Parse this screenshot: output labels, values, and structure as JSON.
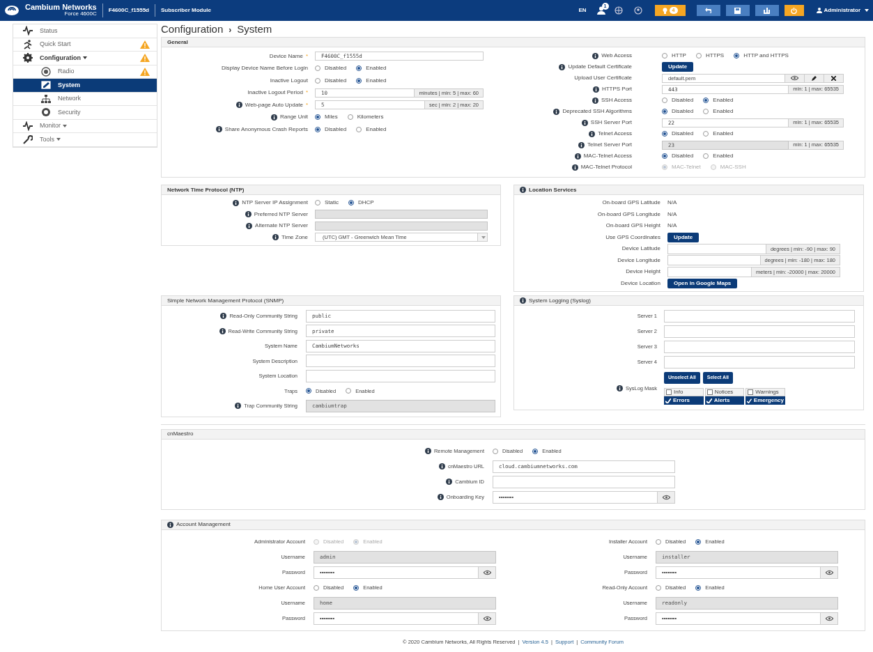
{
  "topbar": {
    "brand": "Cambium Networks",
    "model": "Force 4600C",
    "device": "F4600C_f1555d",
    "mode": "Subscriber Module",
    "language": "EN",
    "notification_badge": "1",
    "alert_badge": "4",
    "user": "Administrator"
  },
  "sidebar": [
    {
      "label": "Status",
      "warning": false,
      "selected": false
    },
    {
      "label": "Quick Start",
      "warning": true,
      "selected": false
    },
    {
      "label": "Configuration",
      "warning": true,
      "selected": false,
      "expanded": true,
      "children": [
        {
          "label": "Radio",
          "warning": true,
          "selected": false
        },
        {
          "label": "System",
          "warning": false,
          "selected": true
        },
        {
          "label": "Network",
          "warning": false,
          "selected": false
        },
        {
          "label": "Security",
          "warning": false,
          "selected": false
        }
      ]
    },
    {
      "label": "Monitor",
      "warning": false,
      "selected": false,
      "expanded": false
    },
    {
      "label": "Tools",
      "warning": false,
      "selected": false,
      "expanded": false
    }
  ],
  "breadcrumb": {
    "parts": [
      "Configuration",
      "System"
    ],
    "separator": "›"
  },
  "general": {
    "title": "General",
    "left": [
      {
        "kind": "input",
        "label": "Device Name",
        "required": "*",
        "info": false,
        "value": "F4600C_f1555d",
        "disabled": false
      },
      {
        "kind": "radio",
        "label": "Display Device Name Before Login",
        "info": false,
        "disabled": false,
        "options": [
          {
            "label": "Disabled",
            "selected": false
          },
          {
            "label": "Enabled",
            "selected": true
          }
        ]
      },
      {
        "kind": "radio",
        "label": "Inactive Logout",
        "info": false,
        "disabled": false,
        "options": [
          {
            "label": "Disabled",
            "selected": false
          },
          {
            "label": "Enabled",
            "selected": true
          }
        ]
      },
      {
        "kind": "input",
        "label": "Inactive Logout Period",
        "required": "*",
        "info": false,
        "value": "10",
        "addon": "minutes | min: 5 | max: 60",
        "disabled": false
      },
      {
        "kind": "input",
        "label": "Web-page Auto Update",
        "required": "*",
        "info": true,
        "value": "5",
        "addon": "sec | min: 2 | max: 20",
        "disabled": false
      },
      {
        "kind": "radio",
        "label": "Range Unit",
        "info": true,
        "disabled": false,
        "options": [
          {
            "label": "Miles",
            "selected": true
          },
          {
            "label": "Kilometers",
            "selected": false
          }
        ]
      },
      {
        "kind": "radio",
        "label": "Share Anonymous Crash Reports",
        "info": true,
        "disabled": false,
        "options": [
          {
            "label": "Disabled",
            "selected": true
          },
          {
            "label": "Enabled",
            "selected": false
          }
        ]
      }
    ],
    "right": [
      {
        "kind": "radio",
        "label": "Web Access",
        "info": true,
        "disabled": false,
        "options": [
          {
            "label": "HTTP",
            "selected": false
          },
          {
            "label": "HTTPS",
            "selected": false
          },
          {
            "label": "HTTP and HTTPS",
            "selected": true
          }
        ]
      },
      {
        "kind": "button",
        "label": "Update Default Certificate",
        "info": true,
        "button": "Update"
      },
      {
        "kind": "file",
        "label": "Upload User Certificate",
        "info": false,
        "value": "default.pem"
      },
      {
        "kind": "input",
        "label": "HTTPS Port",
        "info": true,
        "value": "443",
        "addon": "min: 1 | max: 65535",
        "disabled": false
      },
      {
        "kind": "radio",
        "label": "SSH Access",
        "info": true,
        "disabled": false,
        "options": [
          {
            "label": "Disabled",
            "selected": false
          },
          {
            "label": "Enabled",
            "selected": true
          }
        ]
      },
      {
        "kind": "radio",
        "label": "Deprecated SSH Algorithms",
        "info": true,
        "disabled": false,
        "options": [
          {
            "label": "Disabled",
            "selected": true
          },
          {
            "label": "Enabled",
            "selected": false
          }
        ]
      },
      {
        "kind": "input",
        "label": "SSH Server Port",
        "info": true,
        "value": "22",
        "addon": "min: 1 | max: 65535",
        "disabled": false
      },
      {
        "kind": "radio",
        "label": "Telnet Access",
        "info": true,
        "disabled": false,
        "options": [
          {
            "label": "Disabled",
            "selected": true
          },
          {
            "label": "Enabled",
            "selected": false
          }
        ]
      },
      {
        "kind": "input",
        "label": "Telnet Server Port",
        "info": true,
        "value": "23",
        "addon": "min: 1 | max: 65535",
        "disabled": true
      },
      {
        "kind": "radio",
        "label": "MAC-Telnet Access",
        "info": true,
        "disabled": false,
        "options": [
          {
            "label": "Disabled",
            "selected": true
          },
          {
            "label": "Enabled",
            "selected": false
          }
        ]
      },
      {
        "kind": "radio",
        "label": "MAC-Telnet Protocol",
        "info": true,
        "disabled": true,
        "options": [
          {
            "label": "MAC-Telnet",
            "selected": true
          },
          {
            "label": "MAC-SSH",
            "selected": false
          }
        ]
      }
    ]
  },
  "ntp": {
    "title": "Network Time Protocol (NTP)",
    "info": false,
    "rows": [
      {
        "kind": "radio",
        "label": "NTP Server IP Assignment",
        "info": true,
        "disabled": false,
        "options": [
          {
            "label": "Static",
            "selected": false
          },
          {
            "label": "DHCP",
            "selected": true
          }
        ]
      },
      {
        "kind": "input",
        "label": "Preferred NTP Server",
        "info": true,
        "value": "",
        "disabled": true
      },
      {
        "kind": "input",
        "label": "Alternate NTP Server",
        "info": true,
        "value": "",
        "disabled": true
      },
      {
        "kind": "select",
        "label": "Time Zone",
        "info": true,
        "value": "(UTC) GMT - Greenwich Mean Time"
      }
    ]
  },
  "location": {
    "title": "Location Services",
    "info": true,
    "rows": [
      {
        "kind": "static",
        "label": "On-board GPS Latitude",
        "info": false,
        "value": "N/A"
      },
      {
        "kind": "static",
        "label": "On-board GPS Longitude",
        "info": false,
        "value": "N/A"
      },
      {
        "kind": "static",
        "label": "On-board GPS Height",
        "info": false,
        "value": "N/A"
      },
      {
        "kind": "button",
        "label": "Use GPS Coordinates",
        "info": false,
        "button": "Update"
      },
      {
        "kind": "input",
        "label": "Device Latitude",
        "info": false,
        "value": "",
        "addon": "degrees | min: -90 | max: 90",
        "disabled": false
      },
      {
        "kind": "input",
        "label": "Device Longitude",
        "info": false,
        "value": "",
        "addon": "degrees | min: -180 | max: 180",
        "disabled": false
      },
      {
        "kind": "input",
        "label": "Device Height",
        "info": false,
        "value": "",
        "addon": "meters | min: -20000 | max: 20000",
        "disabled": false
      },
      {
        "kind": "button",
        "label": "Device Location",
        "info": false,
        "button": "Open in Google Maps"
      }
    ]
  },
  "snmp": {
    "title": "Simple Network Management Protocol (SNMP)",
    "info": false,
    "rows": [
      {
        "kind": "input",
        "label": "Read-Only Community String",
        "info": true,
        "value": "public",
        "disabled": false
      },
      {
        "kind": "input",
        "label": "Read-Write Community String",
        "info": true,
        "value": "private",
        "disabled": false
      },
      {
        "kind": "input",
        "label": "System Name",
        "info": false,
        "value": "CambiumNetworks",
        "disabled": false
      },
      {
        "kind": "input",
        "label": "System Description",
        "info": false,
        "value": "",
        "disabled": false
      },
      {
        "kind": "input",
        "label": "System Location",
        "info": false,
        "value": "",
        "disabled": false
      },
      {
        "kind": "radio",
        "label": "Traps",
        "info": false,
        "disabled": false,
        "options": [
          {
            "label": "Disabled",
            "selected": true
          },
          {
            "label": "Enabled",
            "selected": false
          }
        ]
      },
      {
        "kind": "input",
        "label": "Trap Community String",
        "info": true,
        "value": "cambiumtrap",
        "disabled": true
      }
    ]
  },
  "syslog": {
    "title": "System Logging (Syslog)",
    "info": true,
    "rows": [
      {
        "kind": "input",
        "label": "Server 1",
        "info": false,
        "value": "",
        "disabled": false
      },
      {
        "kind": "input",
        "label": "Server 2",
        "info": false,
        "value": "",
        "disabled": false
      },
      {
        "kind": "input",
        "label": "Server 3",
        "info": false,
        "value": "",
        "disabled": false
      },
      {
        "kind": "input",
        "label": "Server 4",
        "info": false,
        "value": "",
        "disabled": false
      },
      {
        "kind": "mask",
        "label": "SysLog Mask",
        "info": true,
        "buttons": [
          "Unselect All",
          "Select All"
        ],
        "checks": [
          {
            "label": "Info",
            "checked": false
          },
          {
            "label": "Notices",
            "checked": false
          },
          {
            "label": "Warnings",
            "checked": false
          },
          {
            "label": "Errors",
            "checked": true
          },
          {
            "label": "Alerts",
            "checked": true
          },
          {
            "label": "Emergency",
            "checked": true
          }
        ]
      }
    ]
  },
  "cnmaestro": {
    "title": "cnMaestro",
    "info": false,
    "rows": [
      {
        "kind": "radio",
        "label": "Remote Management",
        "info": true,
        "disabled": false,
        "options": [
          {
            "label": "Disabled",
            "selected": false
          },
          {
            "label": "Enabled",
            "selected": true
          }
        ]
      },
      {
        "kind": "input",
        "label": "cnMaestro URL",
        "info": true,
        "value": "cloud.cambiumnetworks.com",
        "disabled": false
      },
      {
        "kind": "input",
        "label": "Cambium ID",
        "info": true,
        "value": "",
        "disabled": false
      },
      {
        "kind": "password",
        "label": "Onboarding Key",
        "info": true,
        "value": "••••••••"
      }
    ]
  },
  "accounts": {
    "title": "Account Management",
    "info": true,
    "left": [
      {
        "kind": "radio",
        "label": "Administrator Account",
        "info": false,
        "disabled": true,
        "options": [
          {
            "label": "Disabled",
            "selected": false
          },
          {
            "label": "Enabled",
            "selected": true
          }
        ]
      },
      {
        "kind": "input",
        "label": "Username",
        "info": false,
        "value": "admin",
        "disabled": true
      },
      {
        "kind": "password",
        "label": "Password",
        "info": false,
        "value": "••••••••"
      },
      {
        "kind": "radio",
        "label": "Home User Account",
        "info": false,
        "disabled": false,
        "options": [
          {
            "label": "Disabled",
            "selected": false
          },
          {
            "label": "Enabled",
            "selected": true
          }
        ]
      },
      {
        "kind": "input",
        "label": "Username",
        "info": false,
        "value": "home",
        "disabled": true
      },
      {
        "kind": "password",
        "label": "Password",
        "info": false,
        "value": "••••••••"
      }
    ],
    "right": [
      {
        "kind": "radio",
        "label": "Installer Account",
        "info": false,
        "disabled": false,
        "options": [
          {
            "label": "Disabled",
            "selected": false
          },
          {
            "label": "Enabled",
            "selected": true
          }
        ]
      },
      {
        "kind": "input",
        "label": "Username",
        "info": false,
        "value": "installer",
        "disabled": true
      },
      {
        "kind": "password",
        "label": "Password",
        "info": false,
        "value": "••••••••"
      },
      {
        "kind": "radio",
        "label": "Read-Only Account",
        "info": false,
        "disabled": false,
        "options": [
          {
            "label": "Disabled",
            "selected": false
          },
          {
            "label": "Enabled",
            "selected": true
          }
        ]
      },
      {
        "kind": "input",
        "label": "Username",
        "info": false,
        "value": "readonly",
        "disabled": true
      },
      {
        "kind": "password",
        "label": "Password",
        "info": false,
        "value": "••••••••"
      }
    ]
  },
  "footer": {
    "separator": "|",
    "items": [
      {
        "text": "© 2020 Cambium Networks, All Rights Reserved",
        "link": false
      },
      {
        "text": "Version 4.5",
        "link": true
      },
      {
        "text": "Support",
        "link": true
      },
      {
        "text": "Community Forum",
        "link": true
      }
    ]
  }
}
